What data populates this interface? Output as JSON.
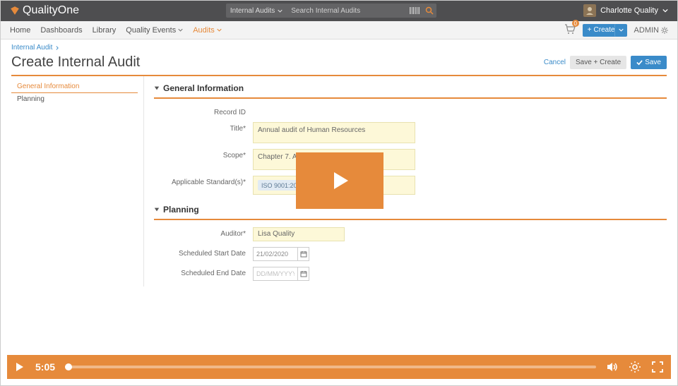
{
  "app": {
    "name": "QualityOne"
  },
  "search": {
    "scope": "Internal Audits",
    "placeholder": "Search Internal Audits"
  },
  "user": {
    "name": "Charlotte Quality"
  },
  "nav": {
    "items": [
      "Home",
      "Dashboards",
      "Library",
      "Quality Events",
      "Audits"
    ],
    "cart_count": "0",
    "create_button": "Create",
    "admin": "ADMIN"
  },
  "breadcrumb": {
    "parent": "Internal Audit"
  },
  "page": {
    "title": "Create Internal Audit"
  },
  "actions": {
    "cancel": "Cancel",
    "save_create": "Save + Create",
    "save": "Save"
  },
  "sidebar": {
    "gen_info": "General Information",
    "planning": "Planning"
  },
  "sections": {
    "gen_info": "General Information",
    "planning": "Planning"
  },
  "form": {
    "record_id": {
      "label": "Record ID"
    },
    "title": {
      "label": "Title*",
      "value": "Annual audit of Human Resources"
    },
    "scope": {
      "label": "Scope*",
      "value": "Chapter 7. All Human Resources"
    },
    "applicable_std": {
      "label": "Applicable Standard(s)*",
      "chip": "ISO 9001:2015"
    },
    "auditor": {
      "label": "Auditor*",
      "value": "Lisa Quality"
    },
    "sched_start": {
      "label": "Scheduled Start Date",
      "value": "21/02/2020"
    },
    "sched_end": {
      "label": "Scheduled End Date",
      "placeholder": "DD/MM/YYYY"
    }
  },
  "video": {
    "time": "5:05"
  }
}
